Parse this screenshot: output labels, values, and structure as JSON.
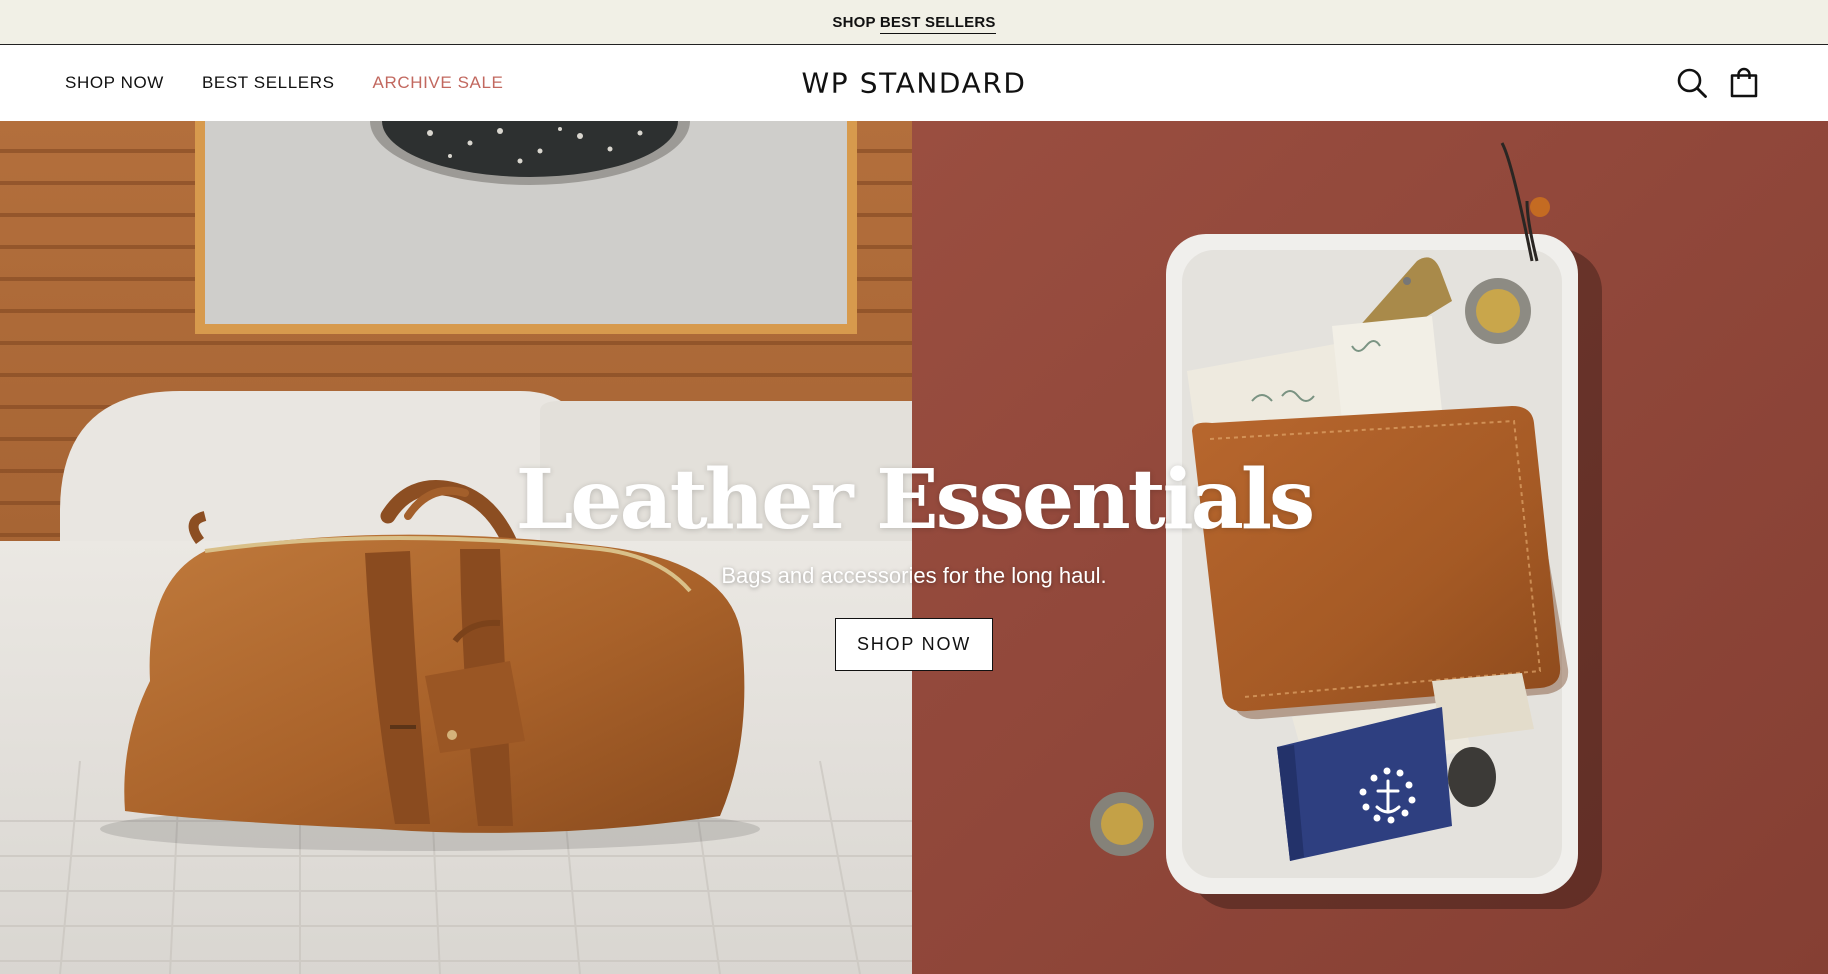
{
  "announcement": {
    "prefix": "SHOP ",
    "link": "BEST SELLERS"
  },
  "nav": {
    "items": [
      {
        "label": "SHOP NOW"
      },
      {
        "label": "BEST SELLERS"
      },
      {
        "label": "ARCHIVE SALE"
      }
    ]
  },
  "brand": {
    "logo": "WP STANDARD"
  },
  "header_icons": [
    "search-icon",
    "shopping-bag-icon"
  ],
  "hero": {
    "title": "Leather Essentials",
    "subtitle": "Bags and accessories for the long haul.",
    "cta": "SHOP NOW",
    "images": [
      "leather-duffel-bag-photo",
      "leather-wallet-tray-photo"
    ]
  },
  "colors": {
    "announcement_bg": "#f1f0e6",
    "sale_link": "#c2685f",
    "hero_right_bg": "#91483b",
    "leather": "#a75f2c"
  }
}
